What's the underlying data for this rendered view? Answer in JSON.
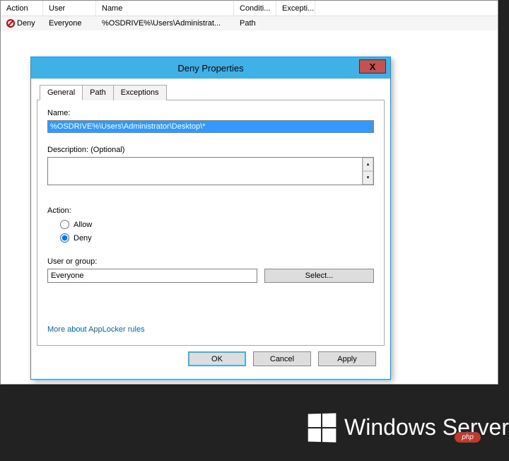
{
  "table": {
    "headers": {
      "action": "Action",
      "user": "User",
      "name": "Name",
      "conditions": "Conditi...",
      "exceptions": "Excepti..."
    },
    "row": {
      "action": "Deny",
      "user": "Everyone",
      "name": "%OSDRIVE%\\Users\\Administrat...",
      "conditions": "Path",
      "exceptions": ""
    }
  },
  "dialog": {
    "title": "Deny Properties",
    "close_label": "X",
    "tabs": {
      "general": "General",
      "path": "Path",
      "exceptions": "Exceptions"
    },
    "fields": {
      "name_label": "Name:",
      "name_value": "%OSDRIVE%\\Users\\Administrator\\Desktop\\*",
      "description_label": "Description: (Optional)",
      "action_label": "Action:",
      "allow_label": "Allow",
      "deny_label": "Deny",
      "user_label": "User or group:",
      "user_value": "Everyone",
      "select_button": "Select...",
      "more_link": "More about AppLocker rules"
    },
    "buttons": {
      "ok": "OK",
      "cancel": "Cancel",
      "apply": "Apply"
    }
  },
  "footer": {
    "brand": "Windows Server",
    "badge": "php"
  }
}
